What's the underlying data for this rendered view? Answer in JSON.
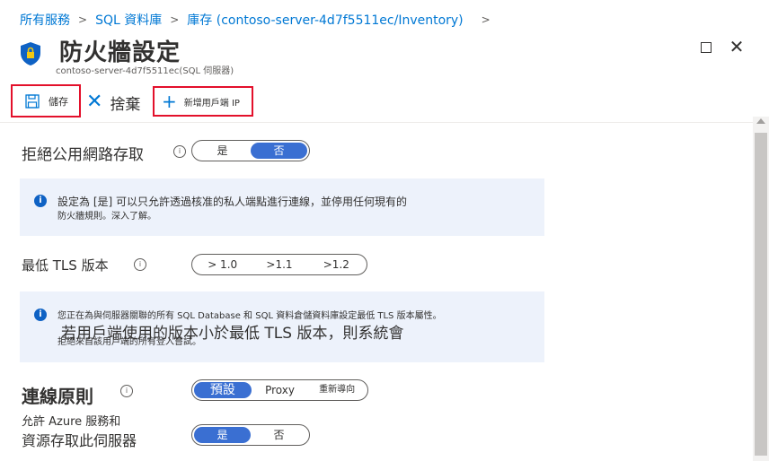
{
  "breadcrumb": {
    "items": [
      "所有服務",
      "SQL 資料庫",
      "庫存 (contoso-server-4d7f5511ec/Inventory)"
    ],
    "separator": ">",
    "trailing": ">"
  },
  "header": {
    "title": "防火牆設定",
    "subtitle": "contoso-server-4d7f5511ec(SQL 伺服器)"
  },
  "toolbar": {
    "save_label": "儲存",
    "discard_label": "捨棄",
    "add_client_ip_label": "新增用戶端 IP"
  },
  "deny_public": {
    "label": "拒絕公用網路存取",
    "options": [
      "是",
      "否"
    ],
    "selected": "否"
  },
  "info1": {
    "line1": "設定為 [是] 可以只允許透過核准的私人端點進行連線，並停用任何現有的",
    "line2": "防火牆規則。深入了解。"
  },
  "tls": {
    "label": "最低 TLS 版本",
    "options": [
      "> 1.0",
      ">1.1",
      ">1.2"
    ]
  },
  "info2": {
    "line1": "您正在為與伺服器關聯的所有 SQL Database 和 SQL 資料倉儲資料庫設定最低 TLS 版本屬性。",
    "line2": "若用戶端使用的版本小於最低 TLS 版本，則系統會",
    "line3": "拒絕來自該用戶端的所有登入嘗試。"
  },
  "connection_policy": {
    "label": "連線原則",
    "options": [
      "預設",
      "Proxy",
      "重新導向"
    ],
    "selected": "預設"
  },
  "allow_azure": {
    "label_line1": "允許 Azure 服務和",
    "label_line2": "資源存取此伺服器",
    "options": [
      "是",
      "否"
    ],
    "selected": "是"
  },
  "colors": {
    "accent": "#0078d4",
    "toggle_on": "#3a6fd2",
    "highlight_box": "#e3102b",
    "info_bg": "#edf2fb"
  }
}
